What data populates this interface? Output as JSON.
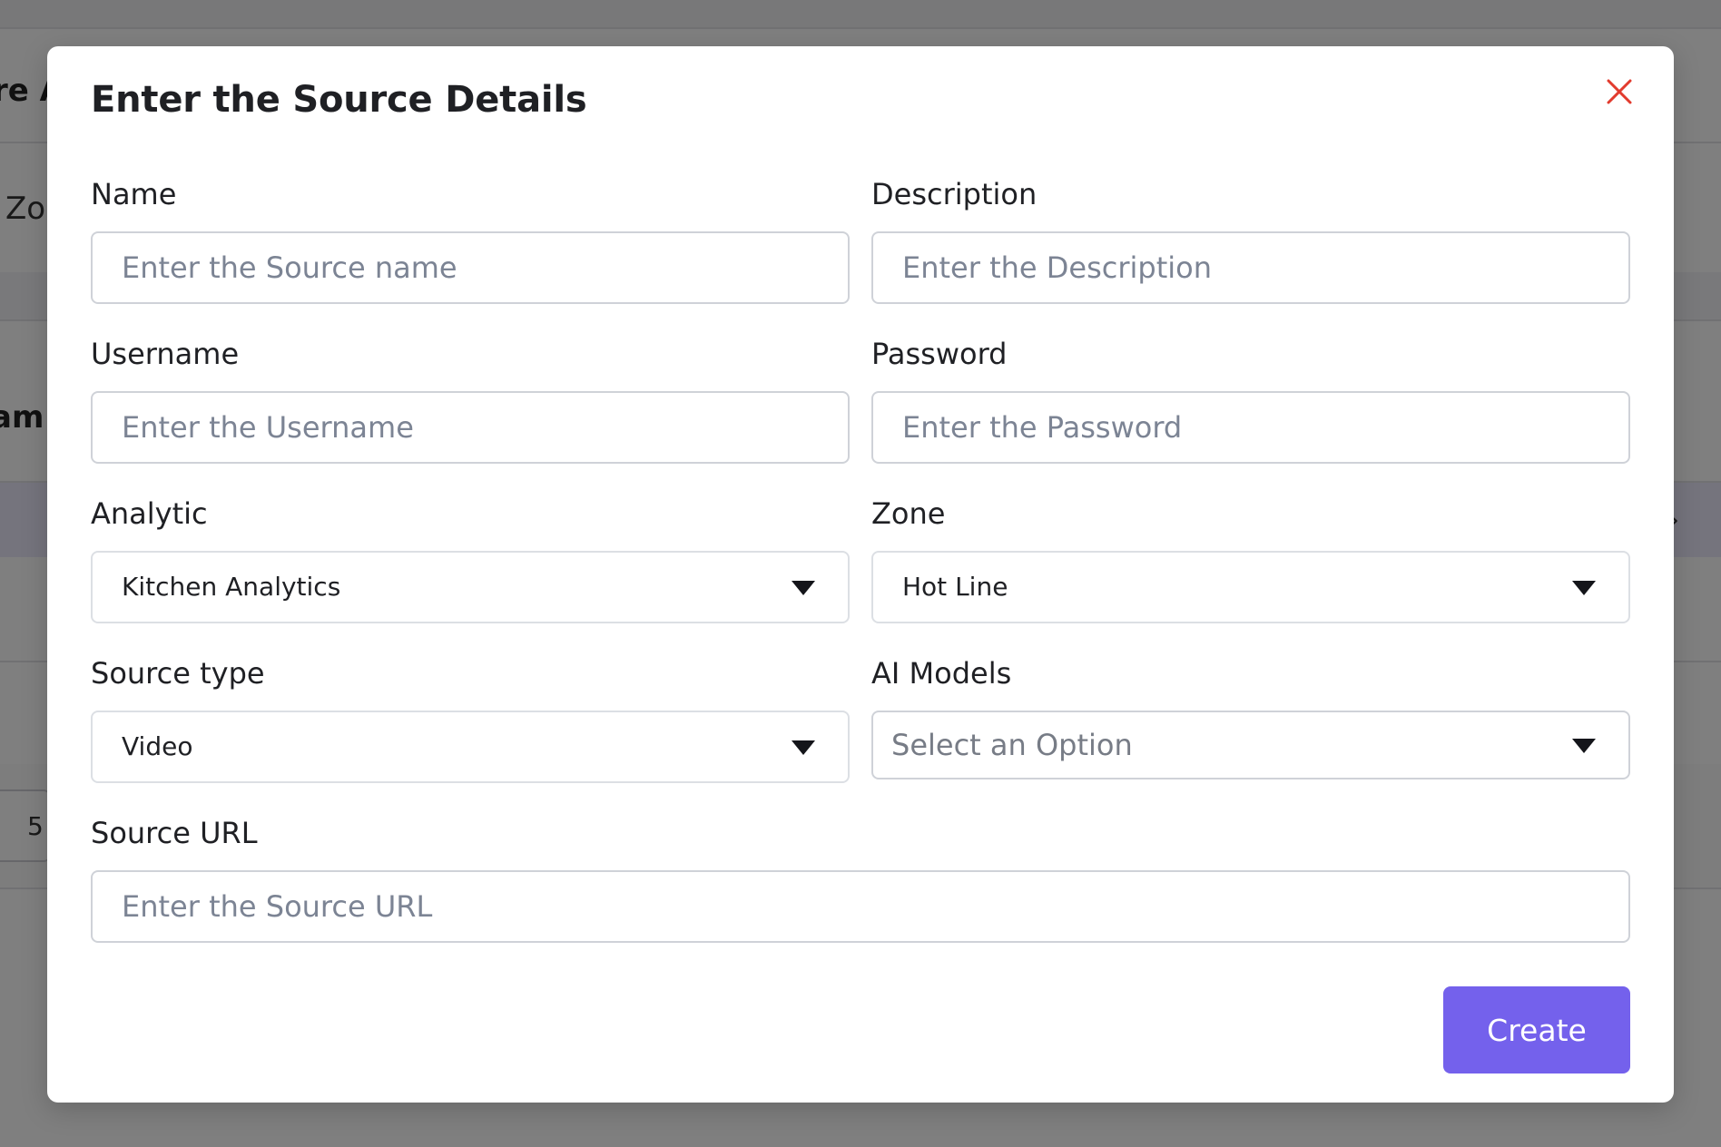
{
  "background": {
    "heading_fragment": "re A",
    "zone_fragment": "Zor",
    "stream_fragment": "am",
    "pager_value": "5",
    "chevron": "›"
  },
  "modal": {
    "title": "Enter the Source Details",
    "close_icon": "close-icon",
    "close_color": "#e23b2e",
    "fields": {
      "name": {
        "label": "Name",
        "placeholder": "Enter the Source name"
      },
      "description": {
        "label": "Description",
        "placeholder": "Enter the Description"
      },
      "username": {
        "label": "Username",
        "placeholder": "Enter the Username"
      },
      "password": {
        "label": "Password",
        "placeholder": "Enter the Password"
      },
      "analytic": {
        "label": "Analytic",
        "value": "Kitchen Analytics"
      },
      "zone": {
        "label": "Zone",
        "value": "Hot Line"
      },
      "source_type": {
        "label": "Source type",
        "value": "Video"
      },
      "ai_models": {
        "label": "AI Models",
        "placeholder": "Select an Option"
      },
      "source_url": {
        "label": "Source URL",
        "placeholder": "Enter the Source URL"
      }
    },
    "create_label": "Create",
    "accent_color": "#7461ec"
  }
}
